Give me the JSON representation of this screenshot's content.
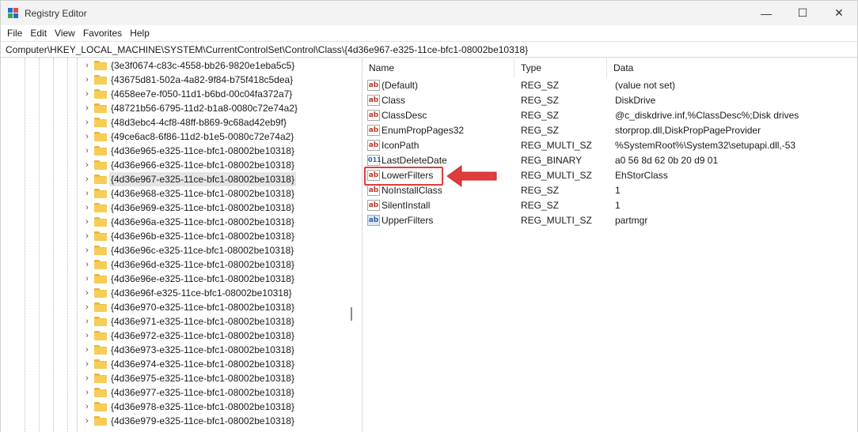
{
  "window": {
    "title": "Registry Editor",
    "controls": {
      "minimize": "—",
      "maximize": "☐",
      "close": "✕"
    }
  },
  "menu": [
    "File",
    "Edit",
    "View",
    "Favorites",
    "Help"
  ],
  "address": "Computer\\HKEY_LOCAL_MACHINE\\SYSTEM\\CurrentControlSet\\Control\\Class\\{4d36e967-e325-11ce-bfc1-08002be10318}",
  "tree": {
    "items": [
      {
        "label": "{3e3f0674-c83c-4558-bb26-9820e1eba5c5}",
        "selected": false
      },
      {
        "label": "{43675d81-502a-4a82-9f84-b75f418c5dea}",
        "selected": false
      },
      {
        "label": "{4658ee7e-f050-11d1-b6bd-00c04fa372a7}",
        "selected": false
      },
      {
        "label": "{48721b56-6795-11d2-b1a8-0080c72e74a2}",
        "selected": false
      },
      {
        "label": "{48d3ebc4-4cf8-48ff-b869-9c68ad42eb9f}",
        "selected": false
      },
      {
        "label": "{49ce6ac8-6f86-11d2-b1e5-0080c72e74a2}",
        "selected": false
      },
      {
        "label": "{4d36e965-e325-11ce-bfc1-08002be10318}",
        "selected": false
      },
      {
        "label": "{4d36e966-e325-11ce-bfc1-08002be10318}",
        "selected": false
      },
      {
        "label": "{4d36e967-e325-11ce-bfc1-08002be10318}",
        "selected": true
      },
      {
        "label": "{4d36e968-e325-11ce-bfc1-08002be10318}",
        "selected": false
      },
      {
        "label": "{4d36e969-e325-11ce-bfc1-08002be10318}",
        "selected": false
      },
      {
        "label": "{4d36e96a-e325-11ce-bfc1-08002be10318}",
        "selected": false
      },
      {
        "label": "{4d36e96b-e325-11ce-bfc1-08002be10318}",
        "selected": false
      },
      {
        "label": "{4d36e96c-e325-11ce-bfc1-08002be10318}",
        "selected": false
      },
      {
        "label": "{4d36e96d-e325-11ce-bfc1-08002be10318}",
        "selected": false
      },
      {
        "label": "{4d36e96e-e325-11ce-bfc1-08002be10318}",
        "selected": false
      },
      {
        "label": "{4d36e96f-e325-11ce-bfc1-08002be10318}",
        "selected": false
      },
      {
        "label": "{4d36e970-e325-11ce-bfc1-08002be10318}",
        "selected": false
      },
      {
        "label": "{4d36e971-e325-11ce-bfc1-08002be10318}",
        "selected": false
      },
      {
        "label": "{4d36e972-e325-11ce-bfc1-08002be10318}",
        "selected": false
      },
      {
        "label": "{4d36e973-e325-11ce-bfc1-08002be10318}",
        "selected": false
      },
      {
        "label": "{4d36e974-e325-11ce-bfc1-08002be10318}",
        "selected": false
      },
      {
        "label": "{4d36e975-e325-11ce-bfc1-08002be10318}",
        "selected": false
      },
      {
        "label": "{4d36e977-e325-11ce-bfc1-08002be10318}",
        "selected": false
      },
      {
        "label": "{4d36e978-e325-11ce-bfc1-08002be10318}",
        "selected": false
      },
      {
        "label": "{4d36e979-e325-11ce-bfc1-08002be10318}",
        "selected": false
      }
    ]
  },
  "values": {
    "headers": {
      "name": "Name",
      "type": "Type",
      "data": "Data"
    },
    "rows": [
      {
        "icon": "string-value-icon",
        "glyph": "ab",
        "name": "(Default)",
        "type": "REG_SZ",
        "data": "(value not set)"
      },
      {
        "icon": "string-value-icon",
        "glyph": "ab",
        "name": "Class",
        "type": "REG_SZ",
        "data": "DiskDrive"
      },
      {
        "icon": "string-value-icon",
        "glyph": "ab",
        "name": "ClassDesc",
        "type": "REG_SZ",
        "data": "@c_diskdrive.inf,%ClassDesc%;Disk drives"
      },
      {
        "icon": "string-value-icon",
        "glyph": "ab",
        "name": "EnumPropPages32",
        "type": "REG_SZ",
        "data": "storprop.dll,DiskPropPageProvider"
      },
      {
        "icon": "string-value-icon",
        "glyph": "ab",
        "name": "IconPath",
        "type": "REG_MULTI_SZ",
        "data": "%SystemRoot%\\System32\\setupapi.dll,-53"
      },
      {
        "icon": "binary-value-icon",
        "glyph": "011",
        "name": "LastDeleteDate",
        "type": "REG_BINARY",
        "data": "a0 56 8d 62 0b 20 d9 01"
      },
      {
        "icon": "string-value-icon",
        "glyph": "ab",
        "name": "LowerFilters",
        "type": "REG_MULTI_SZ",
        "data": "EhStorClass"
      },
      {
        "icon": "string-value-icon",
        "glyph": "ab",
        "name": "NoInstallClass",
        "type": "REG_SZ",
        "data": "1"
      },
      {
        "icon": "string-value-icon",
        "glyph": "ab",
        "name": "SilentInstall",
        "type": "REG_SZ",
        "data": "1"
      },
      {
        "icon": "multi-string-value-icon",
        "glyph": "ab",
        "name": "UpperFilters",
        "type": "REG_MULTI_SZ",
        "data": "partmgr"
      }
    ]
  },
  "annotation": {
    "highlighted_value": "LowerFilters",
    "color": "#e03c3c"
  }
}
